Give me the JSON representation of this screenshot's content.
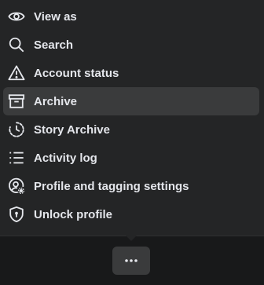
{
  "menu": {
    "items": [
      {
        "label": "View as",
        "icon": "eye-icon"
      },
      {
        "label": "Search",
        "icon": "search-icon"
      },
      {
        "label": "Account status",
        "icon": "warning-icon"
      },
      {
        "label": "Archive",
        "icon": "archive-icon",
        "active": true
      },
      {
        "label": "Story Archive",
        "icon": "story-archive-icon"
      },
      {
        "label": "Activity log",
        "icon": "list-icon"
      },
      {
        "label": "Profile and tagging settings",
        "icon": "profile-settings-icon"
      },
      {
        "label": "Unlock profile",
        "icon": "shield-lock-icon"
      }
    ]
  },
  "more_button": {
    "icon": "more-horizontal-icon"
  },
  "colors": {
    "background": "#18191a",
    "menu_background": "#242526",
    "active_background": "#3a3b3c",
    "text": "#e4e6eb"
  }
}
